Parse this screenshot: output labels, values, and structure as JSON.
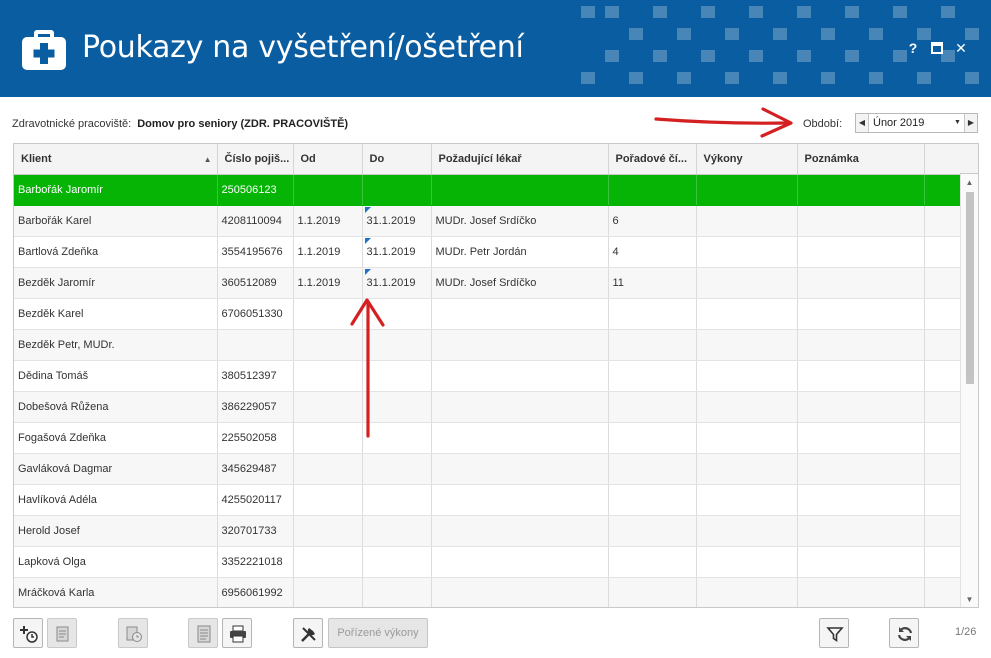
{
  "window": {
    "title": "Poukazy na vyšetření/ošetření",
    "help_label": "?",
    "close_label": "✕"
  },
  "toolbar": {
    "workplace_label": "Zdravotnické pracoviště:",
    "workplace_value": "Domov pro seniory (ZDR. PRACOVIŠTĚ)",
    "period_label": "Období:",
    "period_value": "Únor 2019"
  },
  "grid": {
    "columns": [
      "Klient",
      "Číslo pojiš...",
      "Od",
      "Do",
      "Požadující lékař",
      "Pořadové čí...",
      "Výkony",
      "Poznámka"
    ],
    "rows": [
      [
        "Barbořák Jaromír",
        "250506123",
        "",
        "",
        "",
        "",
        "",
        ""
      ],
      [
        "Barbořák Karel",
        "4208110094",
        "1.1.2019",
        "31.1.2019",
        "MUDr. Josef Srdíčko",
        "6",
        "",
        ""
      ],
      [
        "Bartlová Zdeňka",
        "3554195676",
        "1.1.2019",
        "31.1.2019",
        "MUDr. Petr Jordán",
        "4",
        "",
        ""
      ],
      [
        "Bezděk Jaromír",
        "360512089",
        "1.1.2019",
        "31.1.2019",
        "MUDr. Josef Srdíčko",
        "11",
        "",
        ""
      ],
      [
        "Bezděk Karel",
        "6706051330",
        "",
        "",
        "",
        "",
        "",
        ""
      ],
      [
        "Bezděk Petr, MUDr.",
        "",
        "",
        "",
        "",
        "",
        "",
        ""
      ],
      [
        "Dědina Tomáš",
        "380512397",
        "",
        "",
        "",
        "",
        "",
        ""
      ],
      [
        "Dobešová Růžena",
        "386229057",
        "",
        "",
        "",
        "",
        "",
        ""
      ],
      [
        "Fogašová Zdeňka",
        "225502058",
        "",
        "",
        "",
        "",
        "",
        ""
      ],
      [
        "Gavláková Dagmar",
        "345629487",
        "",
        "",
        "",
        "",
        "",
        ""
      ],
      [
        "Havlíková Adéla",
        "4255020117",
        "",
        "",
        "",
        "",
        "",
        ""
      ],
      [
        "Herold Josef",
        "320701733",
        "",
        "",
        "",
        "",
        "",
        ""
      ],
      [
        "Lapková Olga",
        "3352221018",
        "",
        "",
        "",
        "",
        "",
        ""
      ],
      [
        "Mráčková Karla",
        "6956061992",
        "",
        "",
        "",
        "",
        "",
        ""
      ]
    ],
    "selected_row": 0,
    "flag_color": "#1e73c8",
    "selected_color": "#06b406"
  },
  "bottom": {
    "performed_label": "Pořízené výkony",
    "pager": "1/26"
  },
  "icons": {
    "add_reminder": "add-clock-icon",
    "edit": "edit-document-icon",
    "history": "history-document-icon",
    "document": "document-icon",
    "print": "print-icon",
    "tools": "tools-icon",
    "filter": "filter-icon",
    "refresh": "refresh-icon"
  },
  "colors": {
    "header_bg": "#0a5da0",
    "annotation_arrow": "#d42020"
  }
}
